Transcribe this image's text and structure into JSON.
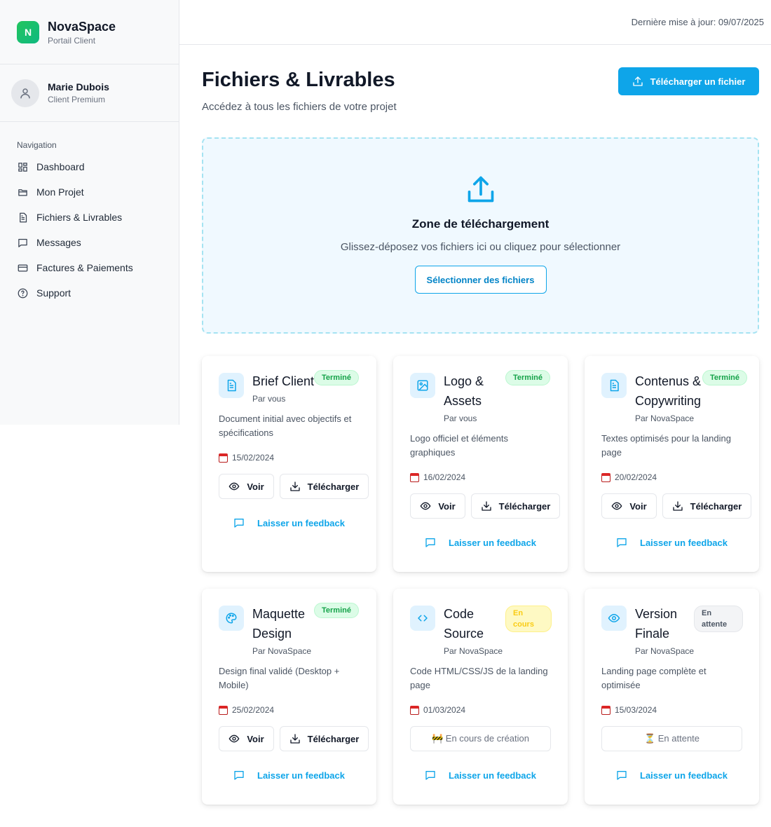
{
  "brand": {
    "logo_letter": "N",
    "name": "NovaSpace",
    "subtitle": "Portail Client"
  },
  "user": {
    "name": "Marie Dubois",
    "role": "Client Premium"
  },
  "nav": {
    "label": "Navigation",
    "items": [
      {
        "label": "Dashboard",
        "icon": "grid-icon"
      },
      {
        "label": "Mon Projet",
        "icon": "folder-icon"
      },
      {
        "label": "Fichiers & Livrables",
        "icon": "file-icon"
      },
      {
        "label": "Messages",
        "icon": "message-icon"
      },
      {
        "label": "Factures & Paiements",
        "icon": "credit-card-icon"
      },
      {
        "label": "Support",
        "icon": "help-circle-icon"
      }
    ]
  },
  "topbar": {
    "updated": "Dernière mise à jour: 09/07/2025"
  },
  "header": {
    "title": "Fichiers & Livrables",
    "subtitle": "Accédez à tous les fichiers de votre projet",
    "upload_label": "Télécharger un fichier"
  },
  "dropzone": {
    "title": "Zone de téléchargement",
    "subtitle": "Glissez-déposez vos fichiers ici ou cliquez pour sélectionner",
    "button": "Sélectionner des fichiers"
  },
  "labels": {
    "view": "Voir",
    "download": "Télécharger",
    "feedback": "Laisser un feedback"
  },
  "files": [
    {
      "title": "Brief Client",
      "author": "Par vous",
      "status": "Terminé",
      "desc": "Document initial avec objectifs et spécifications",
      "date": "15/02/2024",
      "icon": "document-icon"
    },
    {
      "title": "Logo & Assets",
      "author": "Par vous",
      "status": "Terminé",
      "desc": "Logo officiel et éléments graphiques",
      "date": "16/02/2024",
      "icon": "image-icon"
    },
    {
      "title": "Contenus & Copywriting",
      "author": "Par NovaSpace",
      "status": "Terminé",
      "desc": "Textes optimisés pour la landing page",
      "date": "20/02/2024",
      "icon": "document-icon"
    },
    {
      "title": "Maquette Design",
      "author": "Par NovaSpace",
      "status": "Terminé",
      "desc": "Design final validé (Desktop + Mobile)",
      "date": "25/02/2024",
      "icon": "palette-icon"
    },
    {
      "title": "Code Source",
      "author": "Par NovaSpace",
      "status": "En cours",
      "desc": "Code HTML/CSS/JS de la landing page",
      "date": "01/03/2024",
      "icon": "code-icon",
      "action": "🚧 En cours de création"
    },
    {
      "title": "Version Finale",
      "author": "Par NovaSpace",
      "status": "En attente",
      "desc": "Landing page complète et optimisée",
      "date": "15/03/2024",
      "icon": "eye-icon",
      "action": "⏳ En attente"
    }
  ],
  "colors": {
    "accent": "#0ea5e9",
    "success": "#16a34a",
    "warning": "#facc15"
  }
}
